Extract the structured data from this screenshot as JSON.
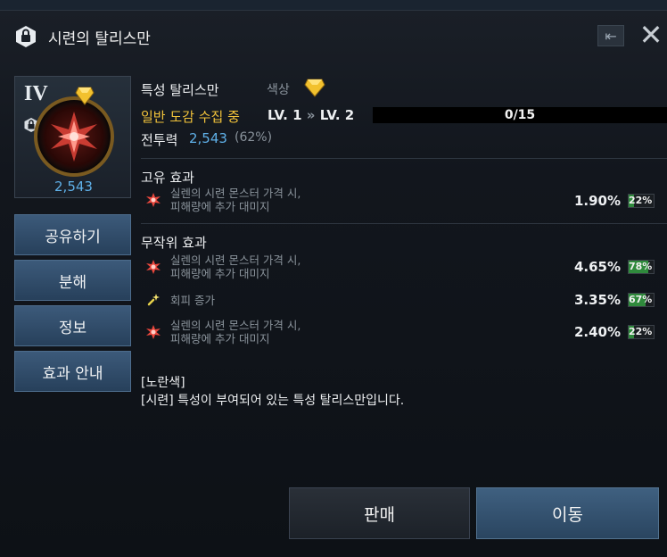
{
  "window": {
    "title": "시련의 탈리스만",
    "back_icon": "exit-arrow-icon",
    "close_icon": "close-icon"
  },
  "item": {
    "grade": "IV",
    "power_value": "2,543",
    "lock_icon": "lock-icon",
    "gem_icon": "yellow-gem-icon"
  },
  "side_buttons": [
    {
      "label": "공유하기"
    },
    {
      "label": "분해"
    },
    {
      "label": "정보"
    },
    {
      "label": "효과 안내"
    }
  ],
  "info": {
    "name": "특성 탈리스만",
    "color_label": "색상",
    "collect_status": "일반 도감 수집 중",
    "level_from": "LV. 1",
    "level_to": "LV. 2",
    "level_arrow": "»",
    "progress_text": "0/15",
    "progress_fraction": 0.0,
    "power_label": "전투력",
    "power_value": "2,543",
    "power_percent": "(62%)"
  },
  "unique_effects": {
    "title": "고유 효과",
    "items": [
      {
        "line1": "실렌의 시련 몬스터 가격 시,",
        "line2": "피해량에 추가 대미지",
        "value": "1.90%",
        "badge": "22%",
        "badge_fraction": 0.22,
        "icon": "red-burst-icon"
      }
    ]
  },
  "random_effects": {
    "title": "무작위 효과",
    "items": [
      {
        "line1": "실렌의 시련 몬스터 가격 시,",
        "line2": "피해량에 추가 대미지",
        "value": "4.65%",
        "badge": "78%",
        "badge_fraction": 0.78,
        "icon": "red-burst-icon"
      },
      {
        "line1": "회피 증가",
        "line2": "",
        "value": "3.35%",
        "badge": "67%",
        "badge_fraction": 0.67,
        "icon": "sparkle-icon"
      },
      {
        "line1": "실렌의 시련 몬스터 가격 시,",
        "line2": "피해량에 추가 대미지",
        "value": "2.40%",
        "badge": "22%",
        "badge_fraction": 0.22,
        "icon": "red-burst-icon"
      }
    ]
  },
  "description": {
    "line1": "[노란색]",
    "line2": "[시련] 특성이 부여되어 있는 특성 탈리스만입니다."
  },
  "bottom_buttons": {
    "sell": "판매",
    "move": "이동"
  },
  "colors": {
    "accent_blue": "#5fb0e8",
    "gold": "#f1c23a",
    "badge_green": "#2f8a3c"
  }
}
